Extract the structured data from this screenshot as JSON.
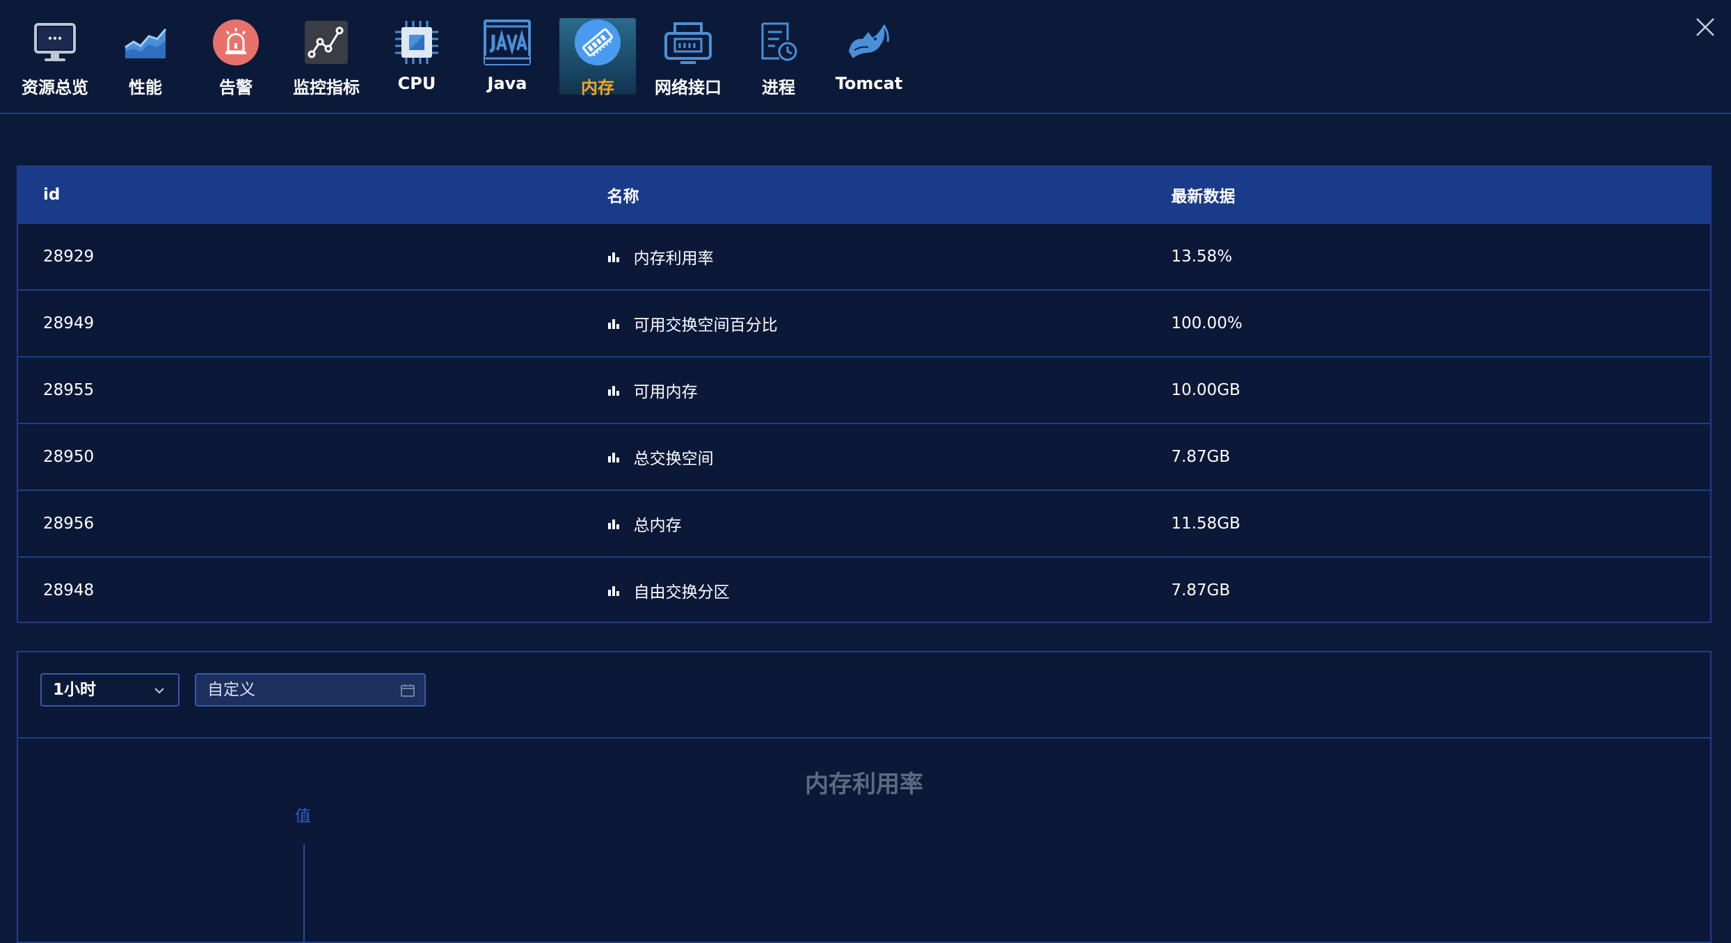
{
  "toolbar": {
    "items": [
      {
        "label": "资源总览",
        "icon": "monitor-icon"
      },
      {
        "label": "性能",
        "icon": "area-chart-icon"
      },
      {
        "label": "告警",
        "icon": "alarm-icon"
      },
      {
        "label": "监控指标",
        "icon": "line-chart-icon"
      },
      {
        "label": "CPU",
        "icon": "cpu-chip-icon"
      },
      {
        "label": "Java",
        "icon": "java-icon"
      },
      {
        "label": "内存",
        "icon": "memory-icon"
      },
      {
        "label": "网络接口",
        "icon": "network-interface-icon"
      },
      {
        "label": "进程",
        "icon": "process-icon"
      },
      {
        "label": "Tomcat",
        "icon": "tomcat-icon"
      }
    ],
    "active": "内存",
    "close_icon": "close-icon"
  },
  "table": {
    "headers": [
      "id",
      "名称",
      "最新数据"
    ],
    "rows": [
      {
        "id": "28929",
        "name": "内存利用率",
        "value": "13.58%"
      },
      {
        "id": "28949",
        "name": "可用交换空间百分比",
        "value": "100.00%"
      },
      {
        "id": "28955",
        "name": "可用内存",
        "value": "10.00GB"
      },
      {
        "id": "28950",
        "name": "总交换空间",
        "value": "7.87GB"
      },
      {
        "id": "28956",
        "name": "总内存",
        "value": "11.58GB"
      },
      {
        "id": "28948",
        "name": "自由交换分区",
        "value": "7.87GB"
      }
    ]
  },
  "filter": {
    "range_selected": "1小时",
    "custom_placeholder": "自定义"
  },
  "chart": {
    "title": "内存利用率",
    "y_label": "值"
  },
  "colors": {
    "background": "#0c1a3a",
    "header_bar": "#1a3a8a",
    "border": "#1f3f86",
    "active_label": "#f5a623"
  }
}
